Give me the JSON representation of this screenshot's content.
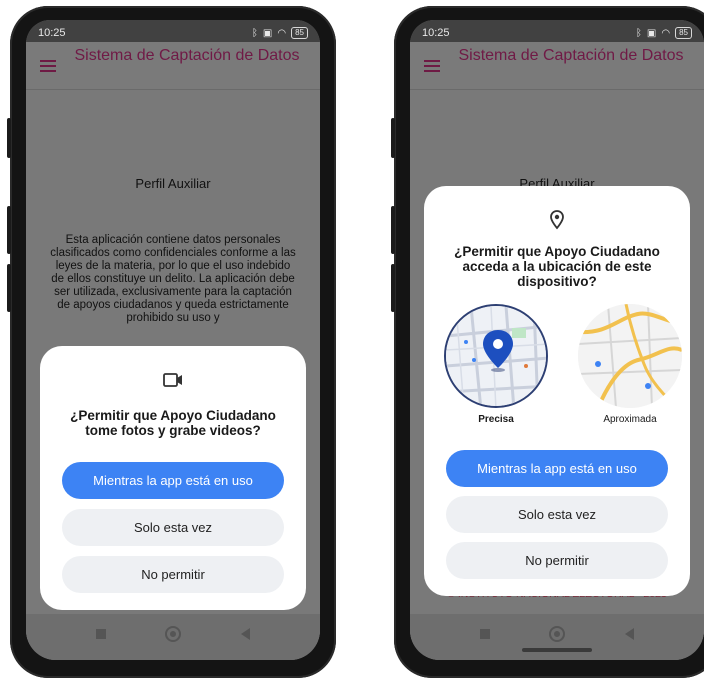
{
  "status": {
    "time": "10:25",
    "battery": "85"
  },
  "app": {
    "title": "Sistema de Captación de Datos",
    "profile": "Perfil Auxiliar",
    "notice": "Esta aplicación contiene datos personales clasificados como confidenciales conforme a las leyes de la materia, por lo que el uso indebido de ellos constituye un delito. La aplicación debe ser utilizada, exclusivamente para la captación de apoyos ciudadanos y queda estrictamente prohibido su uso y",
    "footer": "© INSTITUTO NACIONAL ELECTORAL - 2023"
  },
  "camera_dialog": {
    "icon": "videocam-icon",
    "title": "¿Permitir que Apoyo Ciudadano tome fotos y grabe videos?",
    "buttons": {
      "while_using": "Mientras la app está en uso",
      "only_once": "Solo esta vez",
      "deny": "No permitir"
    }
  },
  "location_dialog": {
    "icon": "location-pin-icon",
    "title": "¿Permitir que Apoyo Ciudadano acceda a la ubicación de este dispositivo?",
    "options": {
      "precise": "Precisa",
      "approximate": "Aproximada"
    },
    "buttons": {
      "while_using": "Mientras la app está en uso",
      "only_once": "Solo esta vez",
      "deny": "No permitir"
    }
  },
  "colors": {
    "primary_button": "#3d83f4",
    "app_title": "#701a46",
    "dialog_bg": "#ffffff",
    "scrim": "#777777"
  }
}
